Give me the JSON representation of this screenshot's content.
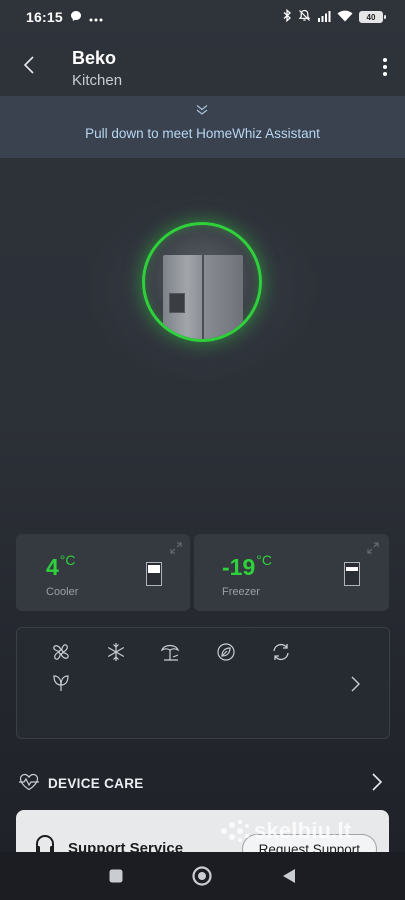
{
  "status_bar": {
    "time": "16:15",
    "battery": "40",
    "icons": [
      "messenger-icon",
      "more-dots-icon",
      "bluetooth-icon",
      "mute-icon",
      "signal-icon",
      "wifi-icon",
      "battery-icon"
    ]
  },
  "header": {
    "title": "Beko",
    "subtitle": "Kitchen"
  },
  "banner": {
    "text": "Pull down to meet HomeWhiz Assistant"
  },
  "colors": {
    "accent_green": "#2ed13a",
    "banner_bg": "#3a4250",
    "card_bg": "#353940"
  },
  "cooler": {
    "temp": "4",
    "unit": "°C",
    "label": "Cooler",
    "level": 0.55
  },
  "freezer": {
    "temp": "-19",
    "unit": "°C",
    "label": "Freezer",
    "level": 0.35
  },
  "features": {
    "icons": [
      "fan-icon",
      "snowflake-icon",
      "vacation-icon",
      "eco-fresh-icon",
      "refresh-icon",
      "leaf-icon"
    ]
  },
  "device_care": {
    "label": "DEVICE CARE"
  },
  "support": {
    "title": "Support Service",
    "button": "Request Support"
  },
  "watermark": {
    "text": "skelbiu.lt"
  }
}
